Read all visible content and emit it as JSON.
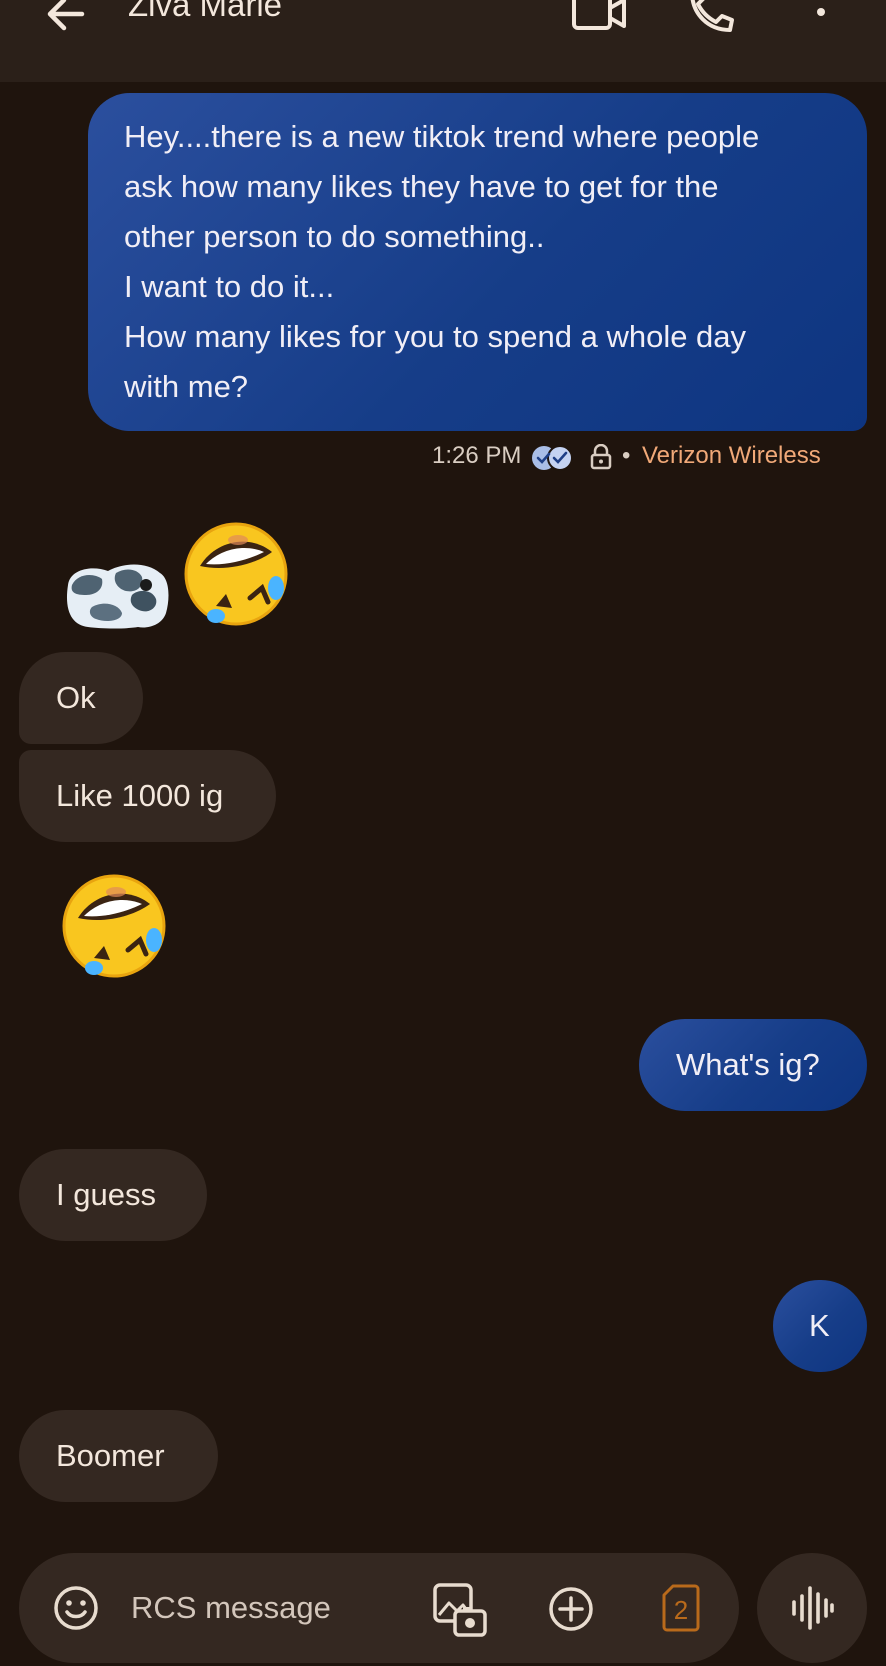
{
  "header": {
    "contact_name": "Ziva Marie",
    "icons": {
      "back": "arrow-left-icon",
      "video": "video-camera-icon",
      "call": "phone-icon",
      "more": "more-vertical-icon"
    }
  },
  "messages": [
    {
      "id": "m1",
      "direction": "outgoing",
      "lines": [
        "Hey....there is a new tiktok trend where people",
        "ask how many likes they have to get for the",
        "other person to do something..",
        "I want to do it...",
        "How many likes for you to spend a whole day",
        "with me?"
      ],
      "meta": {
        "time": "1:26 PM",
        "status_icon": "read-receipt-double-check-icon",
        "encryption_icon": "lock-icon",
        "separator": "•",
        "carrier": "Verizon Wireless"
      }
    },
    {
      "id": "m2",
      "direction": "incoming",
      "type": "sticker",
      "icon": "cow-sticker"
    },
    {
      "id": "m3",
      "direction": "incoming",
      "type": "emoji",
      "icon": "rolling-on-floor-laughing-emoji"
    },
    {
      "id": "m4",
      "direction": "incoming",
      "text": "Ok"
    },
    {
      "id": "m5",
      "direction": "incoming",
      "text": "Like 1000 ig"
    },
    {
      "id": "m6",
      "direction": "incoming",
      "type": "emoji",
      "icon": "rolling-on-floor-laughing-emoji"
    },
    {
      "id": "m7",
      "direction": "outgoing",
      "text": "What's ig?"
    },
    {
      "id": "m8",
      "direction": "incoming",
      "text": "I guess"
    },
    {
      "id": "m9",
      "direction": "outgoing",
      "text": "K"
    },
    {
      "id": "m10",
      "direction": "incoming",
      "text": "Boomer"
    }
  ],
  "composer": {
    "placeholder": "RCS message",
    "sim_label": "2",
    "icons": {
      "emoji": "emoji-smile-icon",
      "gallery": "gallery-icon",
      "add": "add-circle-icon",
      "sim": "sim-card-icon",
      "voice": "voice-waveform-icon"
    }
  },
  "colors": {
    "background": "#1f140d",
    "header": "#2b2019",
    "incoming_bubble": "#342821",
    "outgoing_bubble": "#163d88",
    "carrier_text": "#f1a978",
    "sim_accent": "#b96a1b"
  }
}
